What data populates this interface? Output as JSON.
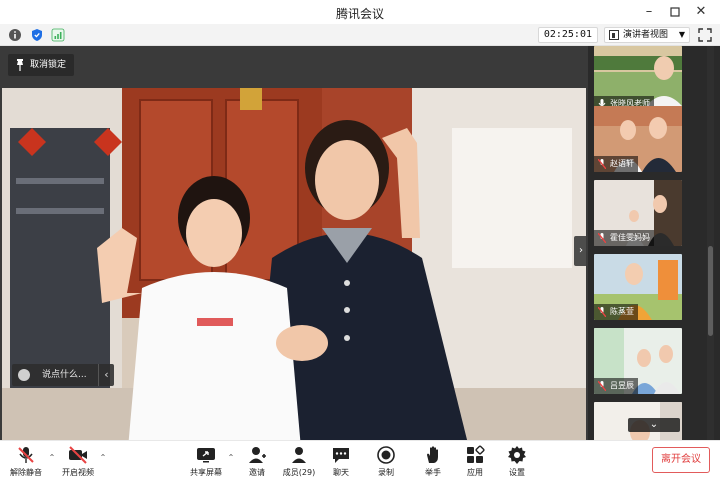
{
  "window": {
    "title": "腾讯会议"
  },
  "infobar": {
    "timer": "02:25:01",
    "view_mode": "演讲者视图",
    "icons": [
      "info-icon",
      "shield-icon",
      "signal-icon",
      "fullscreen-icon"
    ]
  },
  "stage": {
    "unlock_label": "取消锁定",
    "chat_placeholder": "说点什么..."
  },
  "participants": [
    {
      "name": "张晓风老师",
      "mic": "unmuted"
    },
    {
      "name": "赵语轩",
      "mic": "muted"
    },
    {
      "name": "霍佳雯妈妈",
      "mic": "muted"
    },
    {
      "name": "陈蒸萱",
      "mic": "muted"
    },
    {
      "name": "吕昱辰",
      "mic": "muted"
    },
    {
      "name": "",
      "mic": "muted"
    }
  ],
  "toolbar": {
    "unmute": "解除静音",
    "video": "开启视频",
    "share": "共享屏幕",
    "invite": "邀请",
    "members": "成员(29)",
    "chat": "聊天",
    "record": "录制",
    "raise_hand": "举手",
    "apps": "应用",
    "settings": "设置",
    "leave": "离开会议"
  },
  "colors": {
    "leave_red": "#e03d3d",
    "muted_red": "#e84343",
    "stage_bg": "#3a3a3a",
    "accent_blue": "#1f6fe5"
  }
}
